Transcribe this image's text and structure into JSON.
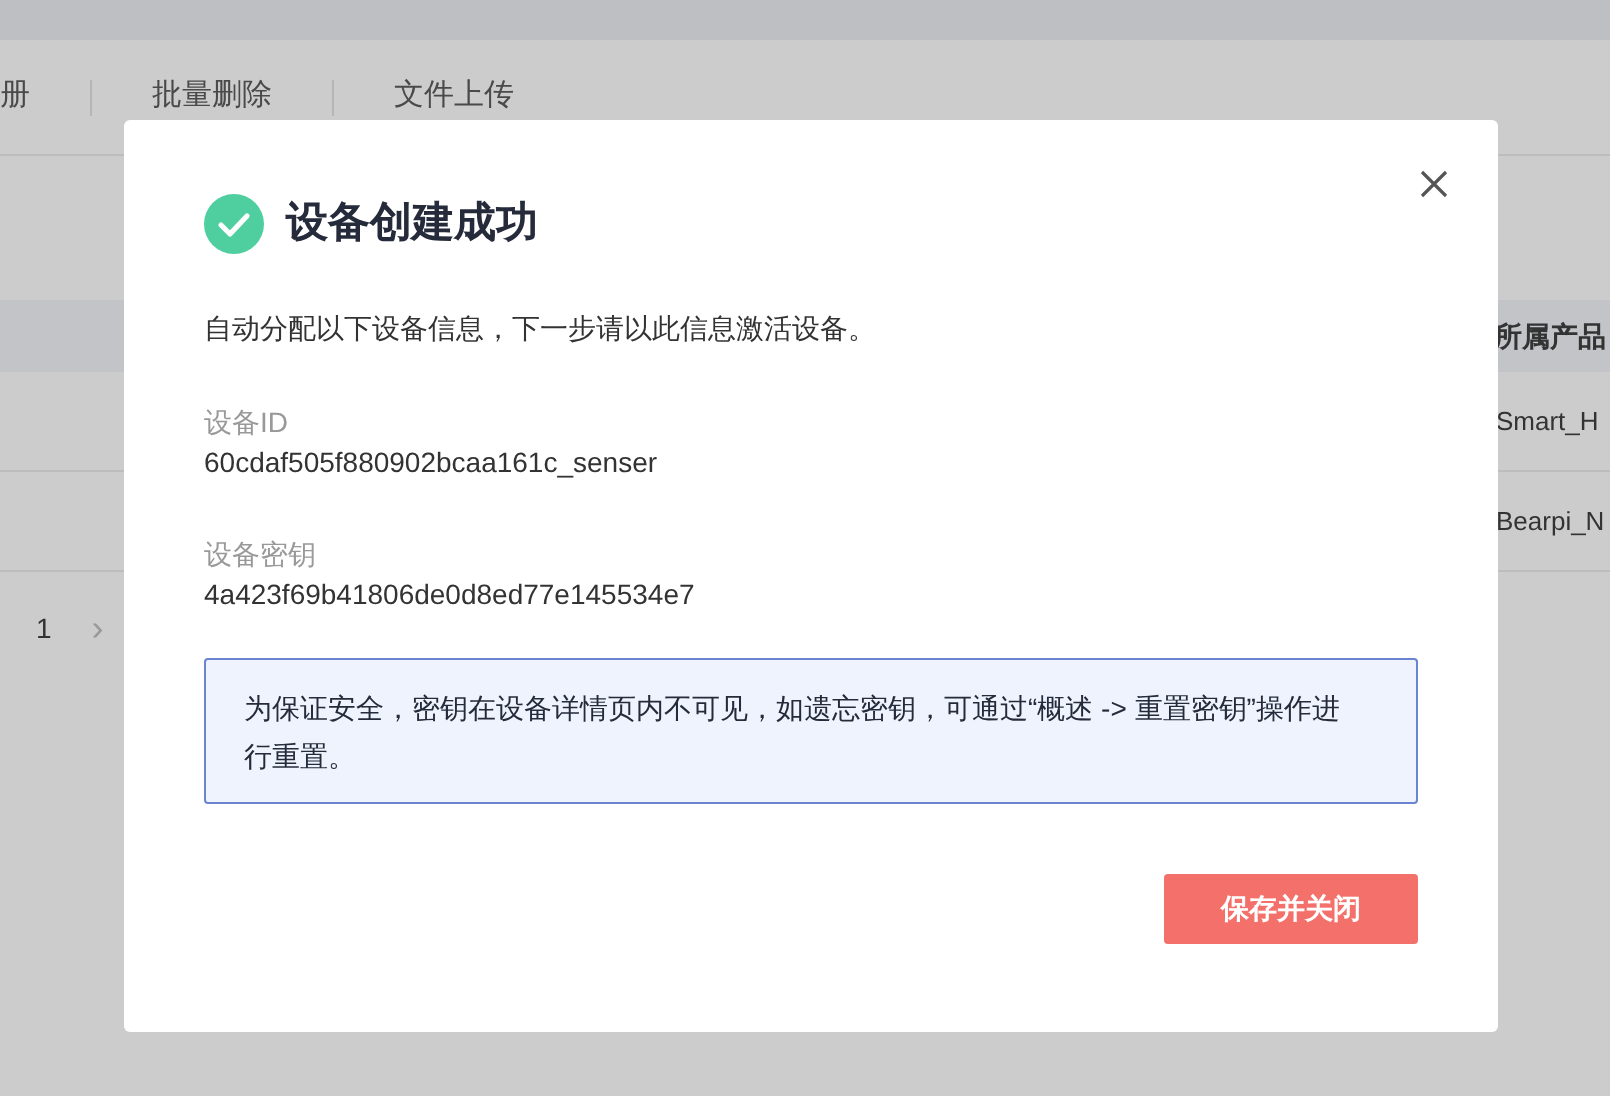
{
  "toolbar": {
    "items": [
      "册",
      "批量删除",
      "文件上传"
    ]
  },
  "table": {
    "columns": [
      "所属产品"
    ],
    "rows": [
      {
        "product": "Smart_H"
      },
      {
        "product": "Bearpi_N"
      }
    ]
  },
  "pagination": {
    "pages": [
      {
        "label": "1",
        "selected": true
      }
    ],
    "next": "›"
  },
  "dialog": {
    "title": "设备创建成功",
    "description": "自动分配以下设备信息，下一步请以此信息激活设备。",
    "fields": [
      {
        "label": "设备ID",
        "value": "60cdaf505f880902bcaa161c_senser"
      },
      {
        "label": "设备密钥",
        "value": "4a423f69b41806de0d8ed77e145534e7"
      }
    ],
    "notice": "为保证安全，密钥在设备详情页内不可见，如遗忘密钥，可通过“概述 -> 重置密钥”操作进行重置。",
    "button": "保存并关闭"
  }
}
